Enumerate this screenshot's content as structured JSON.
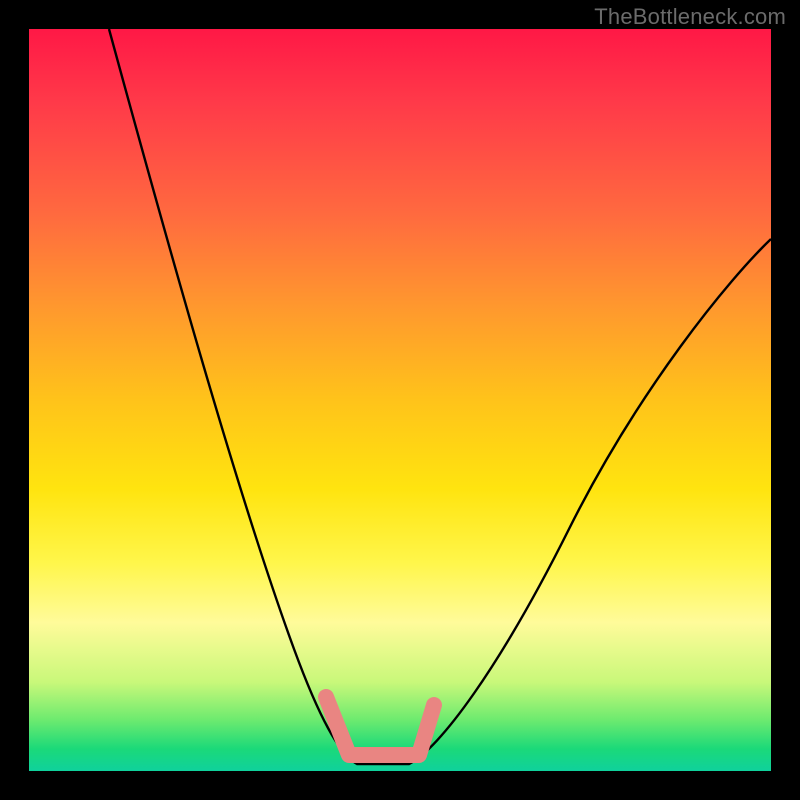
{
  "watermark": "TheBottleneck.com",
  "chart_data": {
    "type": "line",
    "title": "",
    "xlabel": "",
    "ylabel": "",
    "xlim": [
      0,
      100
    ],
    "ylim": [
      0,
      100
    ],
    "series": [
      {
        "name": "bottleneck-curve",
        "x": [
          0,
          4,
          8,
          12,
          16,
          20,
          24,
          28,
          32,
          36,
          40,
          43,
          46,
          48,
          50,
          55,
          60,
          65,
          70,
          75,
          80,
          85,
          90,
          95,
          100
        ],
        "y": [
          100,
          85,
          72,
          60,
          50,
          41,
          33,
          26,
          19,
          13,
          8,
          4,
          1.5,
          0.5,
          0.5,
          2,
          6,
          12,
          19,
          27,
          35,
          43,
          51,
          59,
          67
        ]
      }
    ],
    "annotations": [
      {
        "name": "optimal-range-marker",
        "x_range": [
          40,
          53
        ],
        "y_range": [
          0,
          9
        ],
        "color": "#e98582"
      }
    ],
    "grid": false,
    "legend": false
  }
}
